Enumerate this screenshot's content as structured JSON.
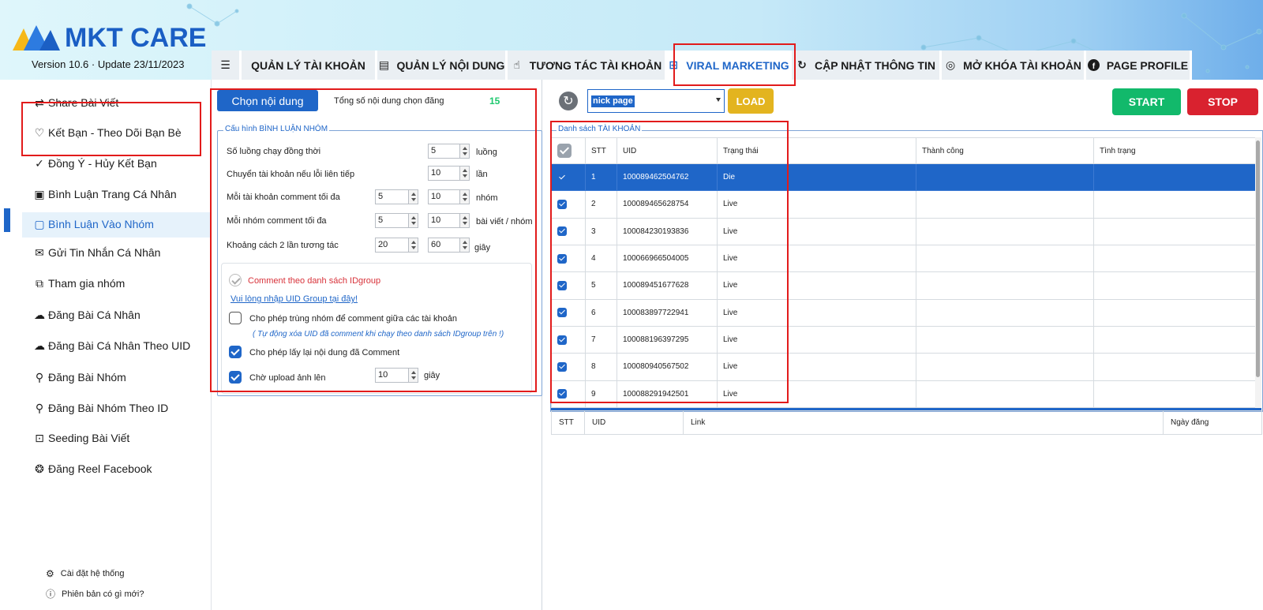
{
  "app": {
    "brand": "MKT CARE",
    "version_text": "Version  10.6 · Update  23/11/2023"
  },
  "tabs": [
    {
      "label": "QUẢN LÝ TÀI KHOẢN",
      "icon": "list-search-icon"
    },
    {
      "label": "QUẢN LÝ NỘI DUNG",
      "icon": "document-icon"
    },
    {
      "label": "TƯƠNG TÁC TÀI KHOẢN",
      "icon": "hand-pointer-icon"
    },
    {
      "label": "VIRAL MARKETING",
      "icon": "grid-icon",
      "active": true
    },
    {
      "label": "CẬP NHẬT THÔNG TIN",
      "icon": "refresh-check-icon"
    },
    {
      "label": "MỞ KHÓA TÀI KHOẢN",
      "icon": "fingerprint-icon"
    },
    {
      "label": "PAGE PROFILE",
      "icon": "facebook-icon"
    }
  ],
  "sidebar": {
    "items": [
      {
        "label": "Share Bài Viết",
        "icon": "share-arrows-icon"
      },
      {
        "label": "Kết Bạn - Theo Dõi Bạn Bè",
        "icon": "heart-handshake-icon"
      },
      {
        "label": "Đồng Ý - Hủy Kết Bạn",
        "icon": "check-badge-icon"
      },
      {
        "label": "Bình Luận Trang Cá Nhân",
        "icon": "profile-card-icon"
      },
      {
        "label": "Bình Luận Vào Nhóm",
        "icon": "comment-icon",
        "active": true
      },
      {
        "label": "Gửi Tin Nhắn Cá Nhân",
        "icon": "mail-icon"
      },
      {
        "label": "Tham gia nhóm",
        "icon": "group-icon"
      },
      {
        "label": "Đăng Bài Cá Nhân",
        "icon": "cloud-upload-icon"
      },
      {
        "label": "Đăng Bài Cá Nhân Theo UID",
        "icon": "cloud-upload-icon"
      },
      {
        "label": "Đăng Bài Nhóm",
        "icon": "people-search-icon"
      },
      {
        "label": "Đăng Bài Nhóm Theo ID",
        "icon": "people-search-icon"
      },
      {
        "label": "Seeding Bài Viết",
        "icon": "seed-box-icon"
      },
      {
        "label": "Đăng Reel Facebook",
        "icon": "reel-icon"
      }
    ],
    "footer": [
      {
        "label": "Cài đặt hệ thống",
        "icon": "gear-icon"
      },
      {
        "label": "Phiên bản có gì mới?",
        "icon": "info-icon"
      }
    ]
  },
  "content": {
    "choose_button": "Chọn nội dung",
    "total_label": "Tổng số nội dung chọn đăng",
    "total_count": "15"
  },
  "config": {
    "title": "Cấu hình BÌNH LUẬN NHÓM",
    "rows": [
      {
        "label": "Số luồng chạy đồng thời",
        "values": [
          "5"
        ],
        "unit": "luồng"
      },
      {
        "label": "Chuyển tài khoản nếu lỗi liên tiếp",
        "values": [
          "10"
        ],
        "unit": "lần"
      },
      {
        "label": "Mỗi tài khoản comment tối đa",
        "values": [
          "5",
          "10"
        ],
        "unit": "nhóm"
      },
      {
        "label": "Mỗi nhóm comment tối đa",
        "values": [
          "5",
          "10"
        ],
        "unit": "bài viết / nhóm"
      },
      {
        "label": "Khoảng cách 2 lần tương tác",
        "values": [
          "20",
          "60"
        ],
        "unit": "giây"
      }
    ],
    "options": {
      "by_idgroup": "Comment theo danh sách IDgroup",
      "idgroup_link": "Vui lòng nhập UID Group tại đây!",
      "allow_duplicate": "Cho phép trùng nhóm để comment giữa các tài khoản",
      "duplicate_note": "( Tự động xóa UID đã comment khi chạy theo danh sách IDgroup trên !)",
      "reuse_content": "Cho phép lấy lại nội dung đã Comment",
      "wait_upload": "Chờ upload ảnh lên",
      "wait_value": "10",
      "wait_unit": "giây"
    }
  },
  "toolbar": {
    "account_filter": "nick page",
    "load_label": "LOAD",
    "start_label": "START",
    "stop_label": "STOP"
  },
  "accounts": {
    "title": "Danh sách TÀI KHOẢN",
    "columns": [
      "STT",
      "UID",
      "Trạng thái",
      "Thành công",
      "Tình trạng"
    ],
    "rows": [
      {
        "stt": "1",
        "uid": "100089462504762",
        "status": "Die"
      },
      {
        "stt": "2",
        "uid": "100089465628754",
        "status": "Live"
      },
      {
        "stt": "3",
        "uid": "100084230193836",
        "status": "Live"
      },
      {
        "stt": "4",
        "uid": "100066966504005",
        "status": "Live"
      },
      {
        "stt": "5",
        "uid": "100089451677628",
        "status": "Live"
      },
      {
        "stt": "6",
        "uid": "100083897722941",
        "status": "Live"
      },
      {
        "stt": "7",
        "uid": "100088196397295",
        "status": "Live"
      },
      {
        "stt": "8",
        "uid": "100080940567502",
        "status": "Live"
      },
      {
        "stt": "9",
        "uid": "100088291942501",
        "status": "Live"
      }
    ]
  },
  "posts": {
    "columns": [
      "STT",
      "UID",
      "Link",
      "Ngày đăng"
    ]
  }
}
